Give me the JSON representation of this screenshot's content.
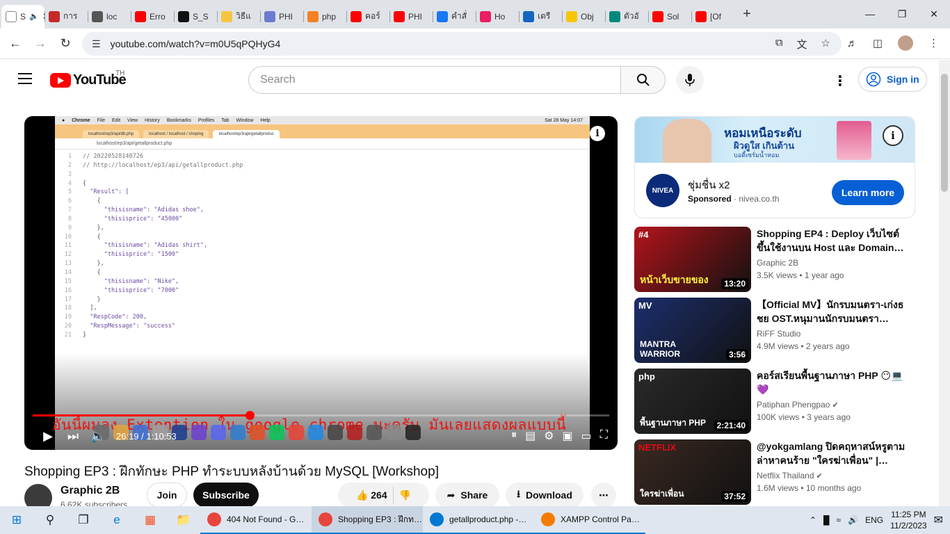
{
  "browser": {
    "tabs": [
      {
        "label": "S",
        "favicon_color": "#ffffff",
        "icon": "speaker-icon",
        "active": true
      },
      {
        "label": "การ",
        "favicon_color": "#c62828"
      },
      {
        "label": "loc",
        "favicon_color": "#555555"
      },
      {
        "label": "Erro",
        "favicon_color": "#ff0000"
      },
      {
        "label": "S_S",
        "favicon_color": "#111111"
      },
      {
        "label": "วิธีแ",
        "favicon_color": "#f5c542"
      },
      {
        "label": "PHI",
        "favicon_color": "#6c7bd1"
      },
      {
        "label": "php",
        "favicon_color": "#f48024"
      },
      {
        "label": "คอร์",
        "favicon_color": "#ff0000"
      },
      {
        "label": "PHI",
        "favicon_color": "#ff0000"
      },
      {
        "label": "คำสั่",
        "favicon_color": "#1877f2"
      },
      {
        "label": "Ho",
        "favicon_color": "#e91e63"
      },
      {
        "label": "เตรี",
        "favicon_color": "#1565c0"
      },
      {
        "label": "Obj",
        "favicon_color": "#f7c600"
      },
      {
        "label": "ตัวอั",
        "favicon_color": "#00897b"
      },
      {
        "label": "Sol",
        "favicon_color": "#ff0000"
      },
      {
        "label": "[Of",
        "favicon_color": "#ff0000"
      }
    ],
    "url": "youtube.com/watch?v=m0U5qPQHyG4"
  },
  "youtube": {
    "logo_text": "YouTube",
    "country": "TH",
    "search_placeholder": "Search",
    "signin_label": "Sign in"
  },
  "video": {
    "mac_menu": [
      "Chrome",
      "File",
      "Edit",
      "View",
      "History",
      "Bookmarks",
      "Profiles",
      "Tab",
      "Window",
      "Help"
    ],
    "mac_clock": "Sat 28 May 14:07",
    "inner_tabs": [
      "localhost/ep3/api/db.php",
      "localhost / localhost / shoping",
      "localhost/ep3/api/getallproduc"
    ],
    "inner_url": "localhost/ep3/api/getallproduct.php",
    "code_lines": [
      {
        "n": "1",
        "t": "// 20220528140726"
      },
      {
        "n": "2",
        "t": "// http://localhost/ep3/api/getallproduct.php"
      },
      {
        "n": "3",
        "t": ""
      },
      {
        "n": "4",
        "t": "{"
      },
      {
        "n": "5",
        "t": "  \"Result\": ["
      },
      {
        "n": "6",
        "t": "    {"
      },
      {
        "n": "7",
        "t": "      \"thisisname\": \"Adidas shoe\","
      },
      {
        "n": "8",
        "t": "      \"thisisprice\": \"45000\""
      },
      {
        "n": "9",
        "t": "    },"
      },
      {
        "n": "10",
        "t": "    {"
      },
      {
        "n": "11",
        "t": "      \"thisisname\": \"Adidas shirt\","
      },
      {
        "n": "12",
        "t": "      \"thisisprice\": \"1500\""
      },
      {
        "n": "13",
        "t": "    },"
      },
      {
        "n": "14",
        "t": "    {"
      },
      {
        "n": "15",
        "t": "      \"thisisname\": \"Nike\","
      },
      {
        "n": "16",
        "t": "      \"thisisprice\": \"7000\""
      },
      {
        "n": "17",
        "t": "    }"
      },
      {
        "n": "18",
        "t": "  ],"
      },
      {
        "n": "19",
        "t": "  \"RespCode\": 200,"
      },
      {
        "n": "20",
        "t": "  \"RespMessage\": \"success\""
      },
      {
        "n": "21",
        "t": "}"
      }
    ],
    "subtitle": "อันนี้ผมลง Extention ใน google chrome นะครับ มันเลยแสดงผลแบบนี้",
    "time_current": "26:19",
    "time_total": "1:10:53",
    "progress_fraction": 0.376,
    "title": "Shopping EP3 : ฝึกทักษะ PHP ทำระบบหลังบ้านด้วย MySQL [Workshop]",
    "channel": "Graphic 2B",
    "subscribers": "6.62K subscribers",
    "join_label": "Join",
    "subscribe_label": "Subscribe",
    "likes": "264",
    "share_label": "Share",
    "download_label": "Download"
  },
  "ad": {
    "banner_line1": "หอมเหนือระดับ",
    "banner_line2": "ผิวดูใส เกินต้าน",
    "banner_line3": "บอดี้เซรั่มน้ำหอม",
    "brand": "NIVEA",
    "title": "ชุ่มชื่น x2",
    "sponsored": "Sponsored",
    "domain": "nivea.co.th",
    "cta": "Learn more"
  },
  "recommendations": [
    {
      "title": "Shopping EP4 : Deploy เว็บไซต์ขึ้นใช้งานบน Host และ Domain…",
      "channel": "Graphic 2B",
      "verified": false,
      "meta": "3.5K views • 1 year ago",
      "duration": "13:20",
      "thumb_text": "หน้าเว็บขายของ",
      "thumb_badge": "#4",
      "thumb_bg": "#b3141b"
    },
    {
      "title": "【Official MV】นักรบมนตรา-เก่งธชย OST.หนุมานนักรบมนตรา…",
      "channel": "RiFF Studio",
      "verified": false,
      "meta": "4.9M views • 2 years ago",
      "duration": "3:56",
      "thumb_text": "MANTRA WARRIOR",
      "thumb_badge": "MV",
      "thumb_bg": "#1c2f6e"
    },
    {
      "title": "คอร์สเรียนพื้นฐานภาษา PHP 😶💻💜",
      "channel": "Patiphan Phengpao",
      "verified": true,
      "meta": "100K views • 3 years ago",
      "duration": "2:21:40",
      "thumb_text": "พื้นฐานภาษา PHP",
      "thumb_badge": "php",
      "thumb_bg": "#2a2a2a"
    },
    {
      "title": "@yokgamlang ปิดคฤหาสน์หรูตามล่าหาคนร้าย \"ใครฆ่าเพื่อน\" |…",
      "channel": "Netflix Thailand",
      "verified": true,
      "meta": "1.6M views • 10 months ago",
      "duration": "37:52",
      "thumb_text": "ใครฆ่าเพื่อน",
      "thumb_badge": "NETFLIX",
      "thumb_bg": "#3a2a22"
    }
  ],
  "taskbar": {
    "apps": [
      {
        "label": "404 Not Found - G…",
        "color": "#e8453c",
        "active": false
      },
      {
        "label": "Shopping EP3 : ฝึกท…",
        "color": "#e8453c",
        "active": true
      },
      {
        "label": "getallproduct.php -…",
        "color": "#0078d4",
        "active": false
      },
      {
        "label": "XAMPP Control Pa…",
        "color": "#f57c00",
        "active": false
      }
    ],
    "lang": "ENG",
    "time": "11:25 PM",
    "date": "11/2/2023"
  }
}
